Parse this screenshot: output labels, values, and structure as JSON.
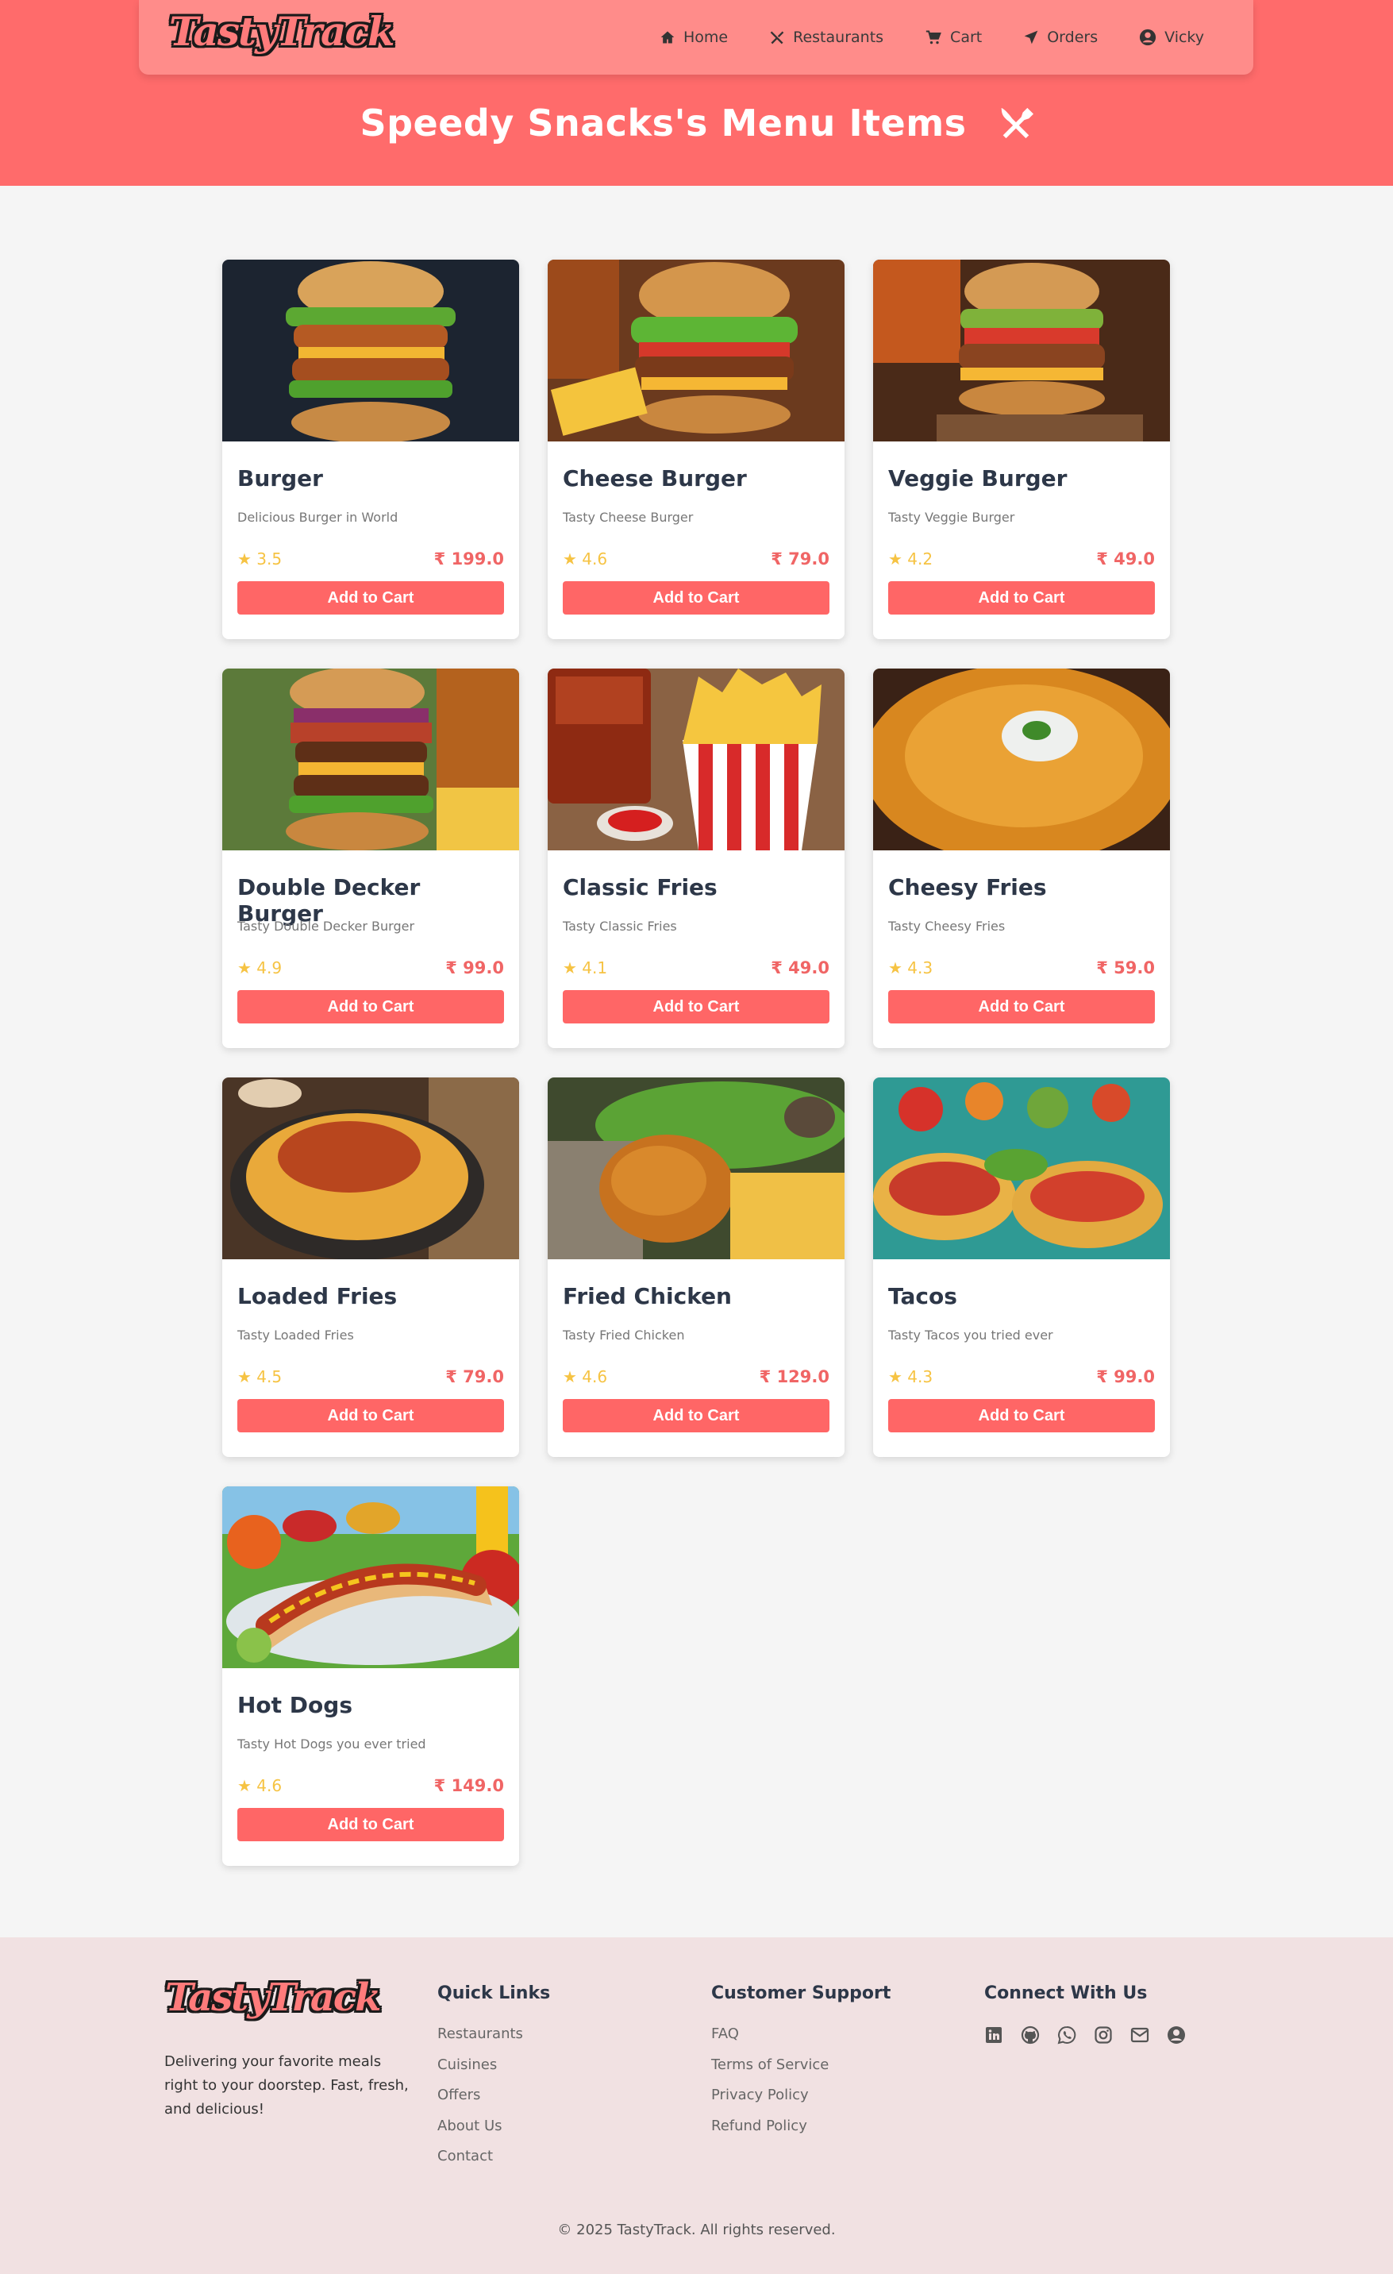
{
  "header": {
    "logo_text": "TastyTrack",
    "nav": [
      {
        "label": "Home",
        "icon": "home-icon"
      },
      {
        "label": "Restaurants",
        "icon": "utensils-icon"
      },
      {
        "label": "Cart",
        "icon": "cart-icon"
      },
      {
        "label": "Orders",
        "icon": "send-icon"
      },
      {
        "label": "Vicky",
        "icon": "user-circle-icon"
      }
    ],
    "page_title": "Speedy Snacks's Menu Items"
  },
  "colors": {
    "primary": "#ff6b6b",
    "nav_bg": "#ff8c8a",
    "price": "#f06565",
    "rating": "#f6c343",
    "footer_bg": "#f1e1e2"
  },
  "items": [
    {
      "name": "Burger",
      "description": "Delicious Burger in World",
      "rating": "★ 3.5",
      "price": "₹ 199.0",
      "button": "Add to Cart",
      "image": "burger"
    },
    {
      "name": "Cheese Burger",
      "description": "Tasty Cheese Burger",
      "rating": "★ 4.6",
      "price": "₹ 79.0",
      "button": "Add to Cart",
      "image": "cheese-burger"
    },
    {
      "name": "Veggie Burger",
      "description": "Tasty Veggie Burger",
      "rating": "★ 4.2",
      "price": "₹ 49.0",
      "button": "Add to Cart",
      "image": "veggie-burger"
    },
    {
      "name": "Double Decker Burger",
      "description": "Tasty Double Decker Burger",
      "rating": "★ 4.9",
      "price": "₹ 99.0",
      "button": "Add to Cart",
      "image": "double-burger"
    },
    {
      "name": "Classic Fries",
      "description": "Tasty Classic Fries",
      "rating": "★ 4.1",
      "price": "₹ 49.0",
      "button": "Add to Cart",
      "image": "classic-fries"
    },
    {
      "name": "Cheesy Fries",
      "description": "Tasty Cheesy Fries",
      "rating": "★ 4.3",
      "price": "₹ 59.0",
      "button": "Add to Cart",
      "image": "cheesy-fries"
    },
    {
      "name": "Loaded Fries",
      "description": "Tasty Loaded Fries",
      "rating": "★ 4.5",
      "price": "₹ 79.0",
      "button": "Add to Cart",
      "image": "loaded-fries"
    },
    {
      "name": "Fried Chicken",
      "description": "Tasty Fried Chicken",
      "rating": "★ 4.6",
      "price": "₹ 129.0",
      "button": "Add to Cart",
      "image": "fried-chicken"
    },
    {
      "name": "Tacos",
      "description": "Tasty Tacos you tried ever",
      "rating": "★ 4.3",
      "price": "₹ 99.0",
      "button": "Add to Cart",
      "image": "tacos"
    },
    {
      "name": "Hot Dogs",
      "description": "Tasty Hot Dogs you ever tried",
      "rating": "★ 4.6",
      "price": "₹ 149.0",
      "button": "Add to Cart",
      "image": "hot-dogs"
    }
  ],
  "footer": {
    "logo_text": "TastyTrack",
    "about": "Delivering your favorite meals right to your doorstep. Fast, fresh, and delicious!",
    "quick_links": {
      "title": "Quick Links",
      "links": [
        "Restaurants",
        "Cuisines",
        "Offers",
        "About Us",
        "Contact"
      ]
    },
    "support": {
      "title": "Customer Support",
      "links": [
        "FAQ",
        "Terms of Service",
        "Privacy Policy",
        "Refund Policy"
      ]
    },
    "connect": {
      "title": "Connect With Us",
      "icons": [
        "linkedin-icon",
        "github-icon",
        "whatsapp-icon",
        "instagram-icon",
        "mail-icon",
        "user-circle-icon"
      ]
    },
    "copyright": "© 2025 TastyTrack. All rights reserved."
  }
}
